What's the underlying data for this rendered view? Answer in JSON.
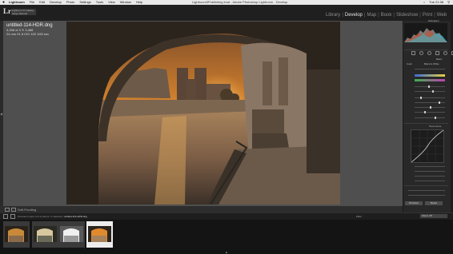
{
  "menubar": {
    "apple": "",
    "items": [
      "Lightroom",
      "File",
      "Edit",
      "Develop",
      "Photo",
      "Settings",
      "Tools",
      "View",
      "Window",
      "Help"
    ],
    "window_title": "Lightroom3Publishing.lrcat - Adobe Photoshop Lightroom - Develop",
    "clock": "Tue 21:36"
  },
  "identity": {
    "logo": "Lr",
    "catalog_line1": "Lightroom 5 Catalog",
    "catalog_line2": "Serge Ramelli"
  },
  "modules": {
    "items": [
      {
        "label": "Library",
        "active": false
      },
      {
        "label": "Develop",
        "active": true
      },
      {
        "label": "Map",
        "active": false
      },
      {
        "label": "Book",
        "active": false
      },
      {
        "label": "Slideshow",
        "active": false
      },
      {
        "label": "Print",
        "active": false
      },
      {
        "label": "Web",
        "active": false
      }
    ],
    "separator": "|"
  },
  "info_overlay": {
    "filename": "untitled-114-HDR.dng",
    "line2": "3,258 of 3 ✕ 3,488",
    "line3": "24 mm  f/1.8  ISO 100  1/60 sec"
  },
  "right_panel": {
    "histogram_title": "Histogram",
    "basic_title": "Basic",
    "tone_curve_title": "Tone Curve",
    "treatment": [
      "Color",
      "Black & White"
    ],
    "previous_button": "Previous",
    "reset_button": "Reset",
    "colors": {
      "highlight": "#3cb5c8",
      "shadow": "#c84f2e",
      "accent": "#e6e6e6"
    }
  },
  "toolbar": {
    "soft_proofing": "Soft Proofing"
  },
  "filmstrip_bar": {
    "source": "Previous Import",
    "count_text": "4 of 4 photos / 1 selected /",
    "selected_file": "untitled-114-HDR.dng",
    "filter_label": "Filter :",
    "filter_value": "Filters Off"
  },
  "filmstrip": {
    "thumbnails": [
      {
        "name": "thumbnail-1",
        "selected": false
      },
      {
        "name": "thumbnail-2",
        "selected": false
      },
      {
        "name": "thumbnail-3",
        "selected": false
      },
      {
        "name": "thumbnail-4",
        "selected": true
      }
    ]
  }
}
